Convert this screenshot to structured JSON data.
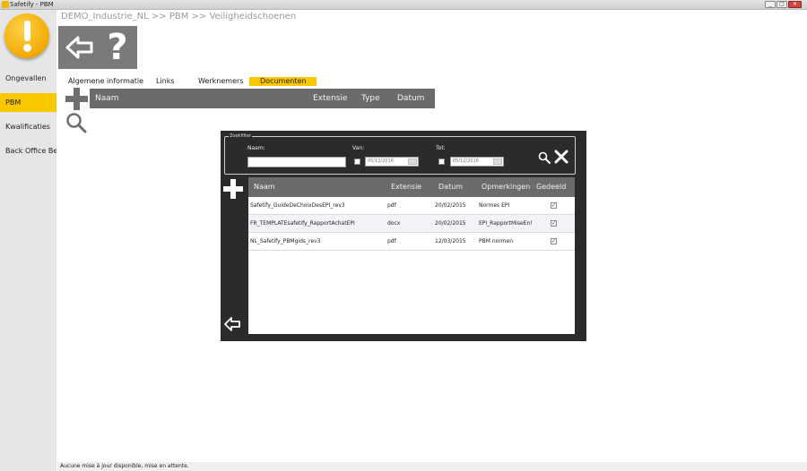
{
  "window": {
    "title": "Safetify - PBM",
    "controls": [
      "_",
      "□",
      "✕"
    ]
  },
  "sidebar": {
    "items": [
      {
        "label": "Ongevallen",
        "active": false
      },
      {
        "label": "PBM",
        "active": true
      },
      {
        "label": "Kwalificaties",
        "active": false
      },
      {
        "label": "Back Office Bedr",
        "active": false
      }
    ]
  },
  "breadcrumb": "DEMO_Industrie_NL >> PBM >> Veiligheidschoenen",
  "toolbar": {
    "help_label": "?"
  },
  "tabs": [
    {
      "label": "Algemene informatie",
      "active": false
    },
    {
      "label": "Links",
      "active": false
    },
    {
      "label": "Werknemers",
      "active": false
    },
    {
      "label": "Documenten",
      "active": true
    }
  ],
  "main_grid": {
    "columns": [
      "Naam",
      "Extensie",
      "Type",
      "Datum"
    ]
  },
  "modal": {
    "filter": {
      "legend": "Zoekfilter",
      "name_label": "Naam:",
      "from_label": "Van:",
      "to_label": "Tot:",
      "from_date": "05/12/2016",
      "to_date": "05/12/2016"
    },
    "columns": [
      "Naam",
      "Extensie",
      "Datum",
      "Opmerkingen",
      "Gedeeld"
    ],
    "rows": [
      {
        "naam": "Safetify_GuideDeChoixDesEPI_rev3",
        "extensie": "pdf",
        "datum": "20/02/2015",
        "opmerkingen": "Normes EPI",
        "gedeeld": true
      },
      {
        "naam": "FR_TEMPLATEsafetify_RapportAchatEPI",
        "extensie": "docx",
        "datum": "20/02/2015",
        "opmerkingen": "EPI_RapportMiseEn!",
        "gedeeld": true
      },
      {
        "naam": "NL_Safetify_PBMgids_rev3",
        "extensie": "pdf",
        "datum": "12/03/2015",
        "opmerkingen": "PBM normen",
        "gedeeld": true
      }
    ]
  },
  "status": "Aucune mise à jour disponible, mise en attente.",
  "colors": {
    "accent": "#f9c800",
    "dark": "#2b2b2b",
    "header": "#6b6b6b"
  }
}
